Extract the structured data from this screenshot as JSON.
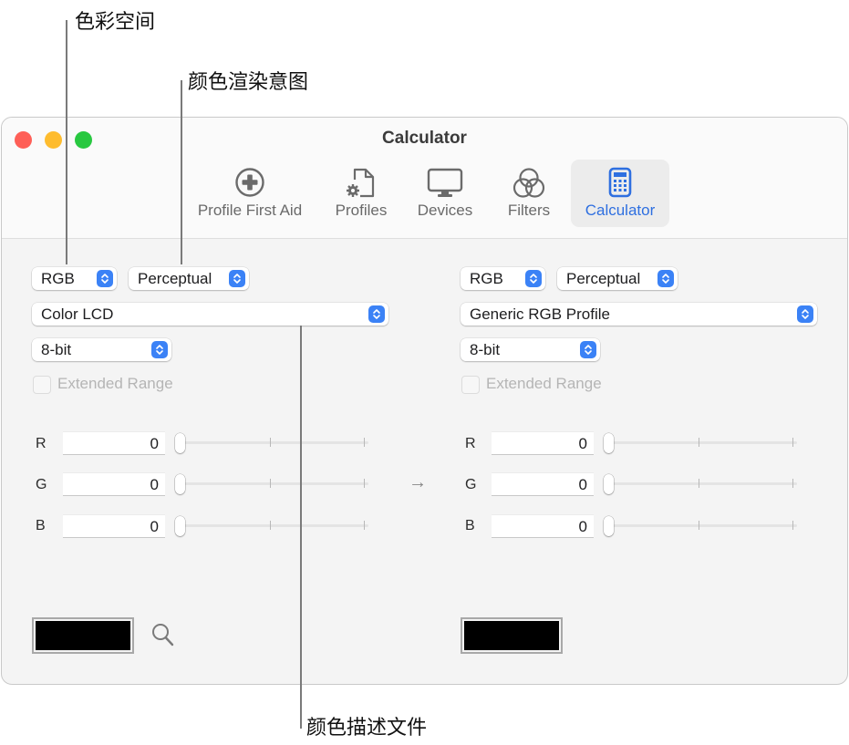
{
  "callouts": {
    "color_space": "色彩空间",
    "rendering_intent": "颜色渲染意图",
    "color_profile": "颜色描述文件"
  },
  "window": {
    "title": "Calculator",
    "traffic_lights": [
      "close",
      "minimize",
      "zoom"
    ]
  },
  "toolbar": {
    "items": [
      {
        "label": "Profile First Aid",
        "icon": "plus-circle-icon",
        "active": false
      },
      {
        "label": "Profiles",
        "icon": "document-gear-icon",
        "active": false
      },
      {
        "label": "Devices",
        "icon": "display-icon",
        "active": false
      },
      {
        "label": "Filters",
        "icon": "overlapping-circles-icon",
        "active": false
      },
      {
        "label": "Calculator",
        "icon": "calculator-icon",
        "active": true
      }
    ]
  },
  "colors": {
    "accent": "#2e6fe0",
    "popup_chevron": "#3b82f6",
    "swatch": "#000000"
  },
  "source": {
    "color_space": "RGB",
    "rendering_intent": "Perceptual",
    "profile": "Color LCD",
    "bit_depth": "8-bit",
    "extended_range_label": "Extended Range",
    "extended_range_checked": false,
    "channels": [
      {
        "label": "R",
        "value": "0",
        "slider_fraction": 0
      },
      {
        "label": "G",
        "value": "0",
        "slider_fraction": 0
      },
      {
        "label": "B",
        "value": "0",
        "slider_fraction": 0
      }
    ]
  },
  "arrow": "→",
  "destination": {
    "color_space": "RGB",
    "rendering_intent": "Perceptual",
    "profile": "Generic RGB Profile",
    "bit_depth": "8-bit",
    "extended_range_label": "Extended Range",
    "extended_range_checked": false,
    "channels": [
      {
        "label": "R",
        "value": "0",
        "slider_fraction": 0
      },
      {
        "label": "G",
        "value": "0",
        "slider_fraction": 0
      },
      {
        "label": "B",
        "value": "0",
        "slider_fraction": 0
      }
    ]
  }
}
